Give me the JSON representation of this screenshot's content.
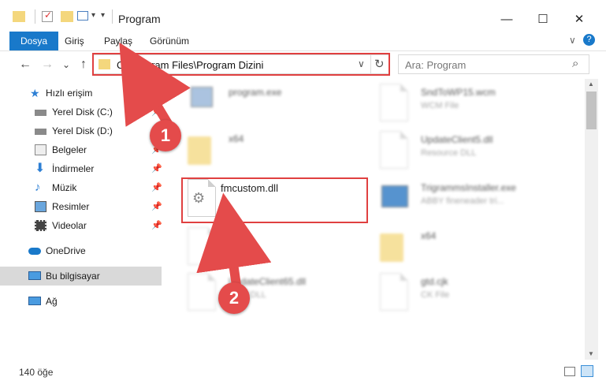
{
  "window": {
    "title": "Program",
    "min_glyph": "—",
    "max_glyph": "☐",
    "close_glyph": "✕"
  },
  "ribbon": {
    "tabs": [
      "Dosya",
      "Giriş",
      "Paylaş",
      "Görünüm"
    ],
    "help": "?",
    "chevron": "∨"
  },
  "address": {
    "path": "C:\\Program Files\\Program Dizini",
    "dropdown": "∨",
    "refresh": "↻"
  },
  "search": {
    "placeholder": "Ara: Program",
    "icon": "⌕"
  },
  "nav": {
    "back": "←",
    "forward": "→",
    "recent": "⌄",
    "up": "↑"
  },
  "sidebar": {
    "items": [
      {
        "label": "Hızlı erişim",
        "icon": "star-icon",
        "pinned": false
      },
      {
        "label": "Yerel Disk (C:)",
        "icon": "drive-icon",
        "pinned": true
      },
      {
        "label": "Yerel Disk (D:)",
        "icon": "drive-icon",
        "pinned": true
      },
      {
        "label": "Belgeler",
        "icon": "documents-icon",
        "pinned": true
      },
      {
        "label": "İndirmeler",
        "icon": "download-icon",
        "pinned": true
      },
      {
        "label": "Müzik",
        "icon": "music-icon",
        "pinned": true
      },
      {
        "label": "Resimler",
        "icon": "pictures-icon",
        "pinned": true
      },
      {
        "label": "Videolar",
        "icon": "videos-icon",
        "pinned": true
      },
      {
        "label": "OneDrive",
        "icon": "cloud-icon",
        "pinned": false
      },
      {
        "label": "Bu bilgisayar",
        "icon": "computer-icon",
        "pinned": false
      },
      {
        "label": "Ağ",
        "icon": "network-icon",
        "pinned": false
      }
    ],
    "pin_glyph": "📌"
  },
  "files": {
    "left": [
      {
        "name": "program.exe",
        "sub": ""
      },
      {
        "name": "x64",
        "sub": ""
      },
      {
        "name": "fmcustom.dll",
        "sub": ""
      },
      {
        "name": "...cjk",
        "sub": "...K File"
      },
      {
        "name": "UpdateClient65.dll",
        "sub": "...rce DLL"
      }
    ],
    "right": [
      {
        "name": "SndToWP15.wcm",
        "sub": "WCM File"
      },
      {
        "name": "UpdateClient5.dll",
        "sub": "Resource DLL"
      },
      {
        "name": "TrigrammsInstaller.exe",
        "sub": "ABBY fineneader tri..."
      },
      {
        "name": "x64",
        "sub": ""
      },
      {
        "name": "gtd.cjk",
        "sub": "CK File"
      }
    ]
  },
  "status": {
    "count": "140 öğe"
  },
  "annotations": {
    "step1": "1",
    "step2": "2"
  },
  "colors": {
    "accent": "#1979ca",
    "annotation": "#e04040"
  }
}
